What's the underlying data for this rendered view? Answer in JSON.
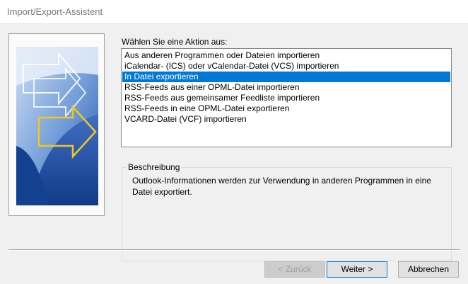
{
  "window": {
    "title": "Import/Export-Assistent"
  },
  "prompt_label": "Wählen Sie eine Aktion aus:",
  "actions": [
    "Aus anderen Programmen oder Dateien importieren",
    "iCalendar- (ICS) oder vCalendar-Datei (VCS) importieren",
    "In Datei exportieren",
    "RSS-Feeds aus einer OPML-Datei importieren",
    "RSS-Feeds aus gemeinsamer Feedliste importieren",
    "RSS-Feeds in eine OPML-Datei exportieren",
    "VCARD-Datei (VCF) importieren"
  ],
  "selected_index": 2,
  "description": {
    "legend": "Beschreibung",
    "text": "Outlook-Informationen werden zur Verwendung in anderen Programmen in eine Datei exportiert."
  },
  "buttons": {
    "back": "< Zurück",
    "next": "Weiter >",
    "cancel": "Abbrechen"
  },
  "colors": {
    "selection": "#0078d7",
    "dialog_bg": "#f0f0f0",
    "wizard_blue": "#2d63b8",
    "arrow_yellow": "#f2c81a"
  }
}
